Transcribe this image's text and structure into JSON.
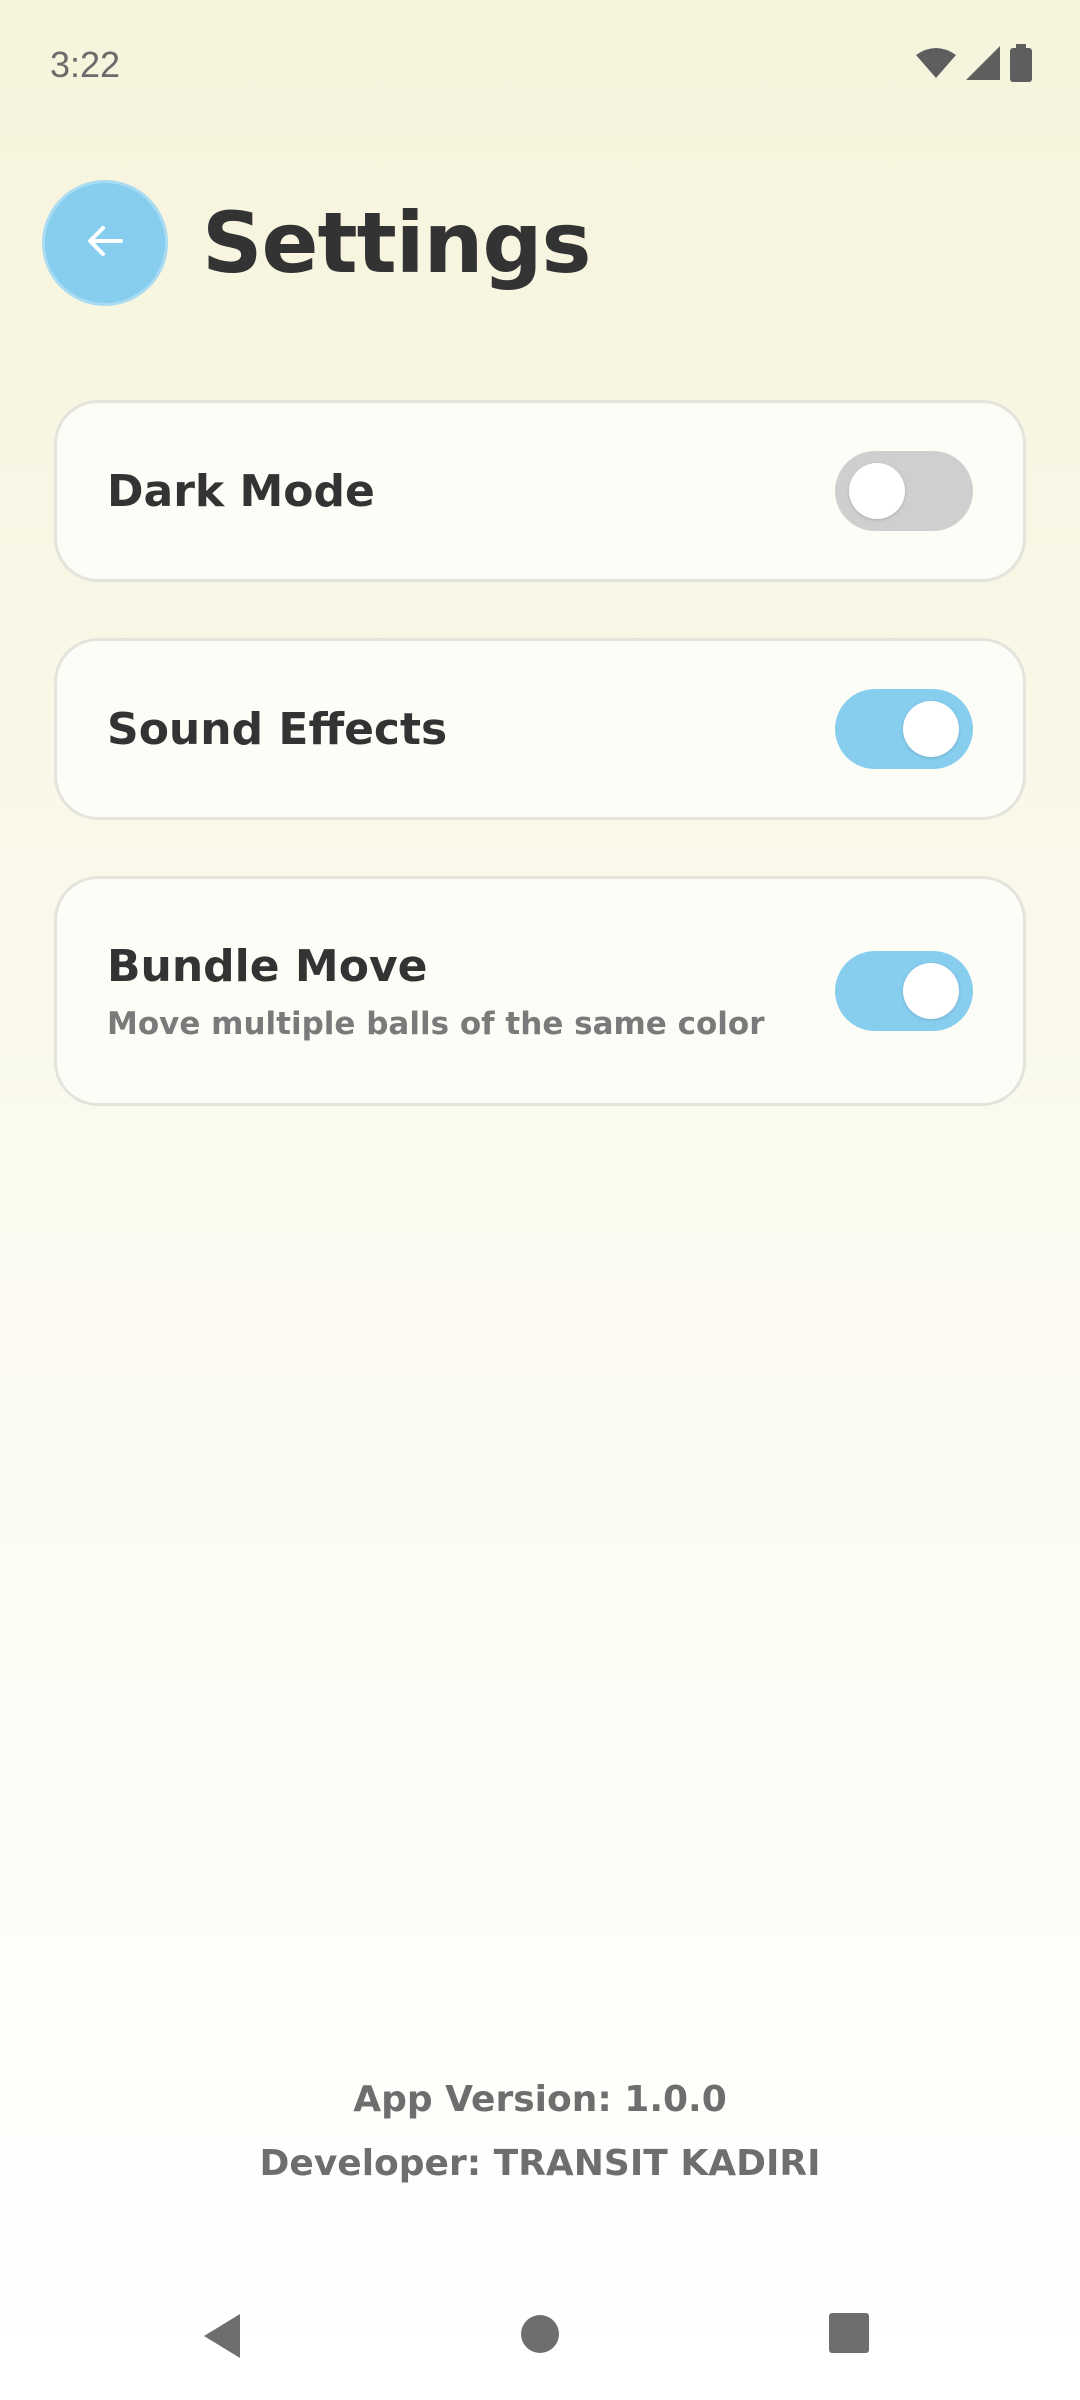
{
  "status_bar": {
    "time": "3:22",
    "icons": [
      "wifi-icon",
      "cell-signal-icon",
      "battery-icon"
    ]
  },
  "header": {
    "back_icon": "arrow-left-icon",
    "title": "Settings"
  },
  "settings": [
    {
      "label": "Dark Mode",
      "description": "",
      "enabled": false
    },
    {
      "label": "Sound Effects",
      "description": "",
      "enabled": true
    },
    {
      "label": "Bundle Move",
      "description": "Move multiple balls of the same color",
      "enabled": true
    }
  ],
  "footer": {
    "version": "App Version: 1.0.0",
    "developer": "Developer: TRANSIT KADIRI"
  },
  "colors": {
    "accent": "#87cdee",
    "toggle_off": "#cfcfcf",
    "text": "#333333",
    "muted_text": "#7a7a7a"
  },
  "nav_bar": {
    "icons": [
      "nav-back-icon",
      "nav-home-icon",
      "nav-recents-icon"
    ]
  }
}
